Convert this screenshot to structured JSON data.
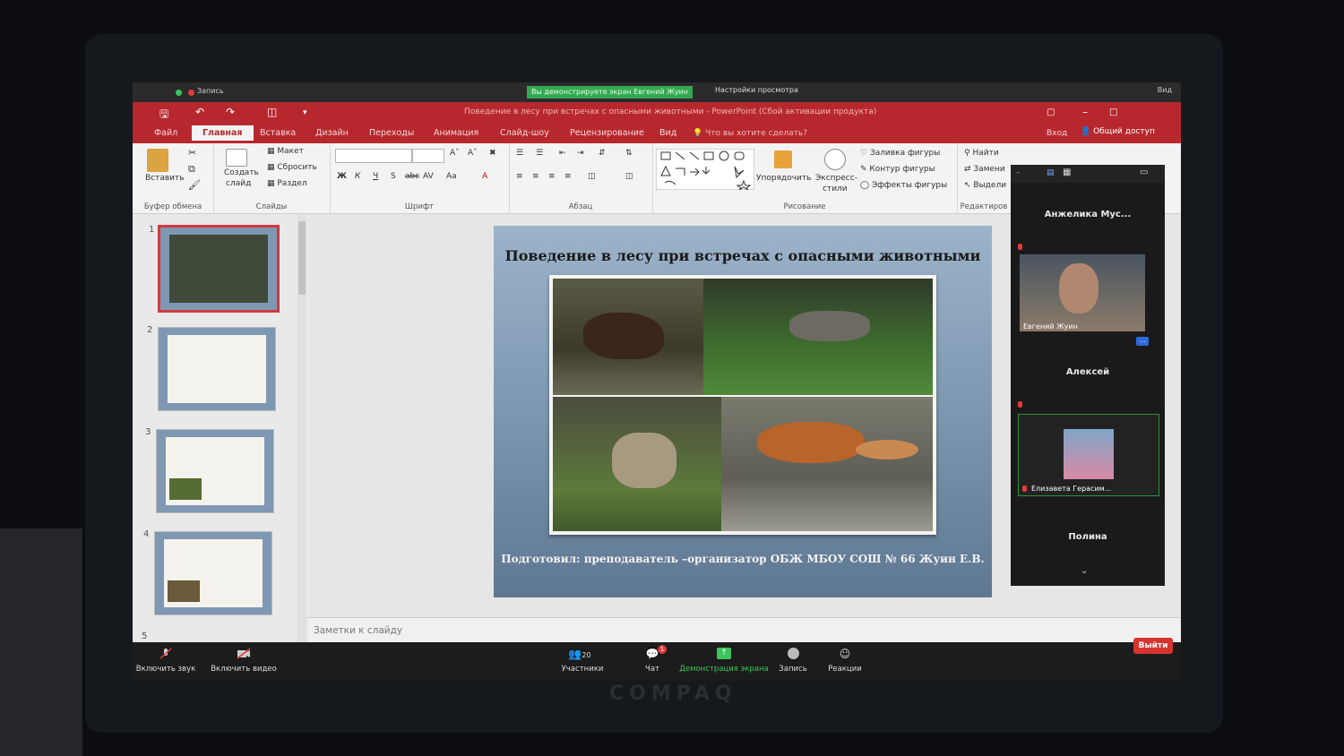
{
  "zoom_top": {
    "sharing_banner": "Вы демонстрируете экран Евгений Жуин",
    "view_options": "Настройки просмотра",
    "recording": "Запись",
    "video": "Вид"
  },
  "ppt": {
    "window_title": "Поведение в лесу при встречах с опасными животными - PowerPoint (Сбой активации продукта)",
    "tabs": [
      "Файл",
      "Главная",
      "Вставка",
      "Дизайн",
      "Переходы",
      "Анимация",
      "Слайд-шоу",
      "Рецензирование",
      "Вид"
    ],
    "active_tab": "Главная",
    "tell_me": "Что вы хотите сделать?",
    "sign_in": "Вход",
    "share": "Общий доступ",
    "ribbon": {
      "clipboard": {
        "paste": "Вставить",
        "label": "Буфер обмена"
      },
      "slides": {
        "new_slide_1": "Создать",
        "new_slide_2": "слайд",
        "layout": "Макет",
        "reset": "Сбросить",
        "section": "Раздел",
        "label": "Слайды"
      },
      "font": {
        "label": "Шрифт",
        "bold": "Ж",
        "italic": "К",
        "underline": "Ч",
        "strike": "S",
        "abc": "abc",
        "spacing": "AV",
        "case": "Aa",
        "color": "A"
      },
      "paragraph": {
        "label": "Абзац"
      },
      "drawing": {
        "arrange": "Упорядочить",
        "quick_styles_1": "Экспресс-",
        "quick_styles_2": "стили",
        "fill": "Заливка фигуры",
        "outline": "Контур фигуры",
        "effects": "Эффекты фигуры",
        "label": "Рисование"
      },
      "editing": {
        "find": "Найти",
        "replace": "Замени",
        "select": "Выдели",
        "label": "Редактиров"
      }
    },
    "thumbnails": [
      {
        "num": "1"
      },
      {
        "num": "2"
      },
      {
        "num": "3"
      },
      {
        "num": "4"
      },
      {
        "num": "5"
      }
    ],
    "slide": {
      "title": "Поведение в лесу при встречах с опасными животными",
      "footer": "Подготовил: преподаватель –организатор ОБЖ МБОУ СОШ № 66 Жуин Е.В."
    },
    "notes_placeholder": "Заметки к слайду"
  },
  "participants": [
    {
      "name": "Анжелика Мус..."
    },
    {
      "name": "Евгений Жуин"
    },
    {
      "name": "Алексей"
    },
    {
      "name": "Елизавета Герасим..."
    },
    {
      "name": "Полина"
    }
  ],
  "zoom_bar": {
    "unmute": "Включить звук",
    "start_video": "Включить видео",
    "participants": "Участники",
    "participants_count": "20",
    "chat": "Чат",
    "chat_badge": "1",
    "share_screen": "Демонстрация экрана",
    "record": "Запись",
    "reactions": "Реакции",
    "leave": "Выйти"
  },
  "colors": {
    "ppt_red": "#b7282e",
    "share_green": "#34a853",
    "leave_red": "#d8342f"
  }
}
